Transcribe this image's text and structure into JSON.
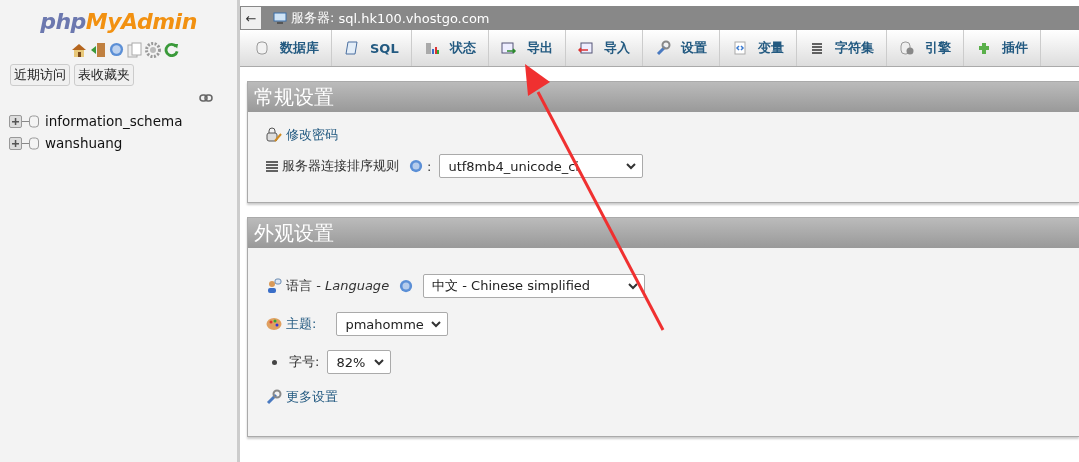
{
  "logo": {
    "part_1": "php",
    "part_2": "MyAdmin"
  },
  "sidebar": {
    "buttons": [
      "近期访问",
      "表收藏夹"
    ],
    "databases": [
      {
        "name": "information_schema",
        "expanded": false
      },
      {
        "name": "wanshuang",
        "expanded": false
      }
    ]
  },
  "breadcrumb": {
    "back": "←",
    "label": "服务器:",
    "server": "sql.hk100.vhostgo.com"
  },
  "tabs": [
    {
      "label": "数据库"
    },
    {
      "label": "SQL"
    },
    {
      "label": "状态"
    },
    {
      "label": "导出"
    },
    {
      "label": "导入"
    },
    {
      "label": "设置"
    },
    {
      "label": "变量"
    },
    {
      "label": "字符集"
    },
    {
      "label": "引擎"
    },
    {
      "label": "插件"
    }
  ],
  "general_settings": {
    "title": "常规设置",
    "change_password": "修改密码",
    "collation_label": "服务器连接排序规则",
    "colon": ":",
    "collation_value": "utf8mb4_unicode_ci"
  },
  "appearance_settings": {
    "title": "外观设置",
    "language_label": "语言 - ",
    "language_italic": "Language",
    "language_value": "中文 - Chinese simplified",
    "theme_label": "主题:",
    "theme_value": "pmahomme",
    "font_size_label": "字号:",
    "font_size_value": "82%",
    "more_settings": "更多设置"
  }
}
